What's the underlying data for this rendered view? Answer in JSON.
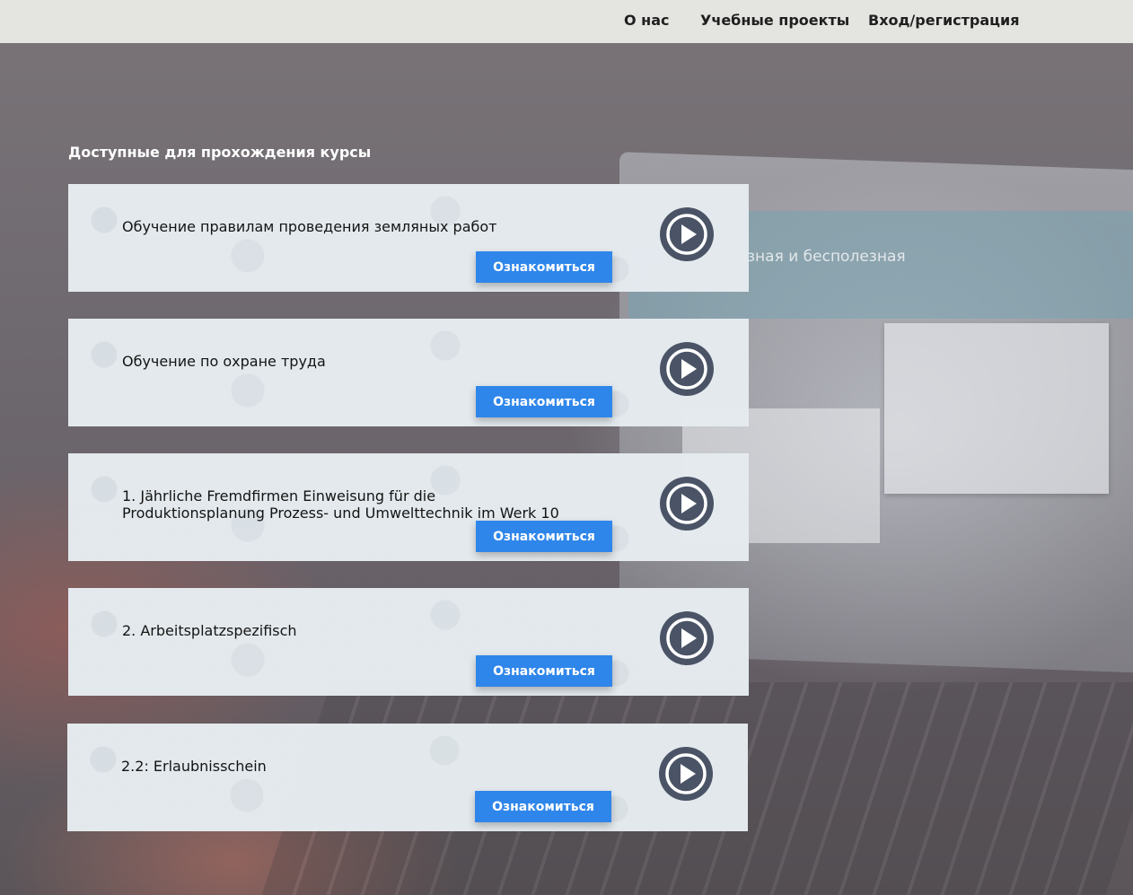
{
  "nav": {
    "about": "О нас",
    "projects": "Учебные проекты",
    "login": "Вход/регистрация"
  },
  "background": {
    "screen_text": "зная и бесполезная"
  },
  "section_title": "Доступные для прохождения курсы",
  "courses": [
    {
      "title_line1": "Обучение правилам проведения земляных работ",
      "title_line2": "",
      "button": "Ознакомиться",
      "icon": "play-icon"
    },
    {
      "title_line1": "Обучение по охране труда",
      "title_line2": "",
      "button": "Ознакомиться",
      "icon": "play-icon"
    },
    {
      "title_line1": "1. Jährliche Fremdfirmen Einweisung für die",
      "title_line2": "Produktionsplanung Prozess- und Umwelttechnik im Werk 10",
      "button": "Ознакомиться",
      "icon": "play-icon"
    },
    {
      "title_line1": "2. Arbeitsplatzspezifisch",
      "title_line2": "",
      "button": "Ознакомиться",
      "icon": "play-icon"
    },
    {
      "title_line1": "2.2: Erlaubnisschein",
      "title_line2": "",
      "button": "Ознакомиться",
      "icon": "play-icon"
    }
  ],
  "colors": {
    "button": "#2f86ea",
    "play_icon": "#4a5466",
    "navbar": "#e4e4e0"
  }
}
